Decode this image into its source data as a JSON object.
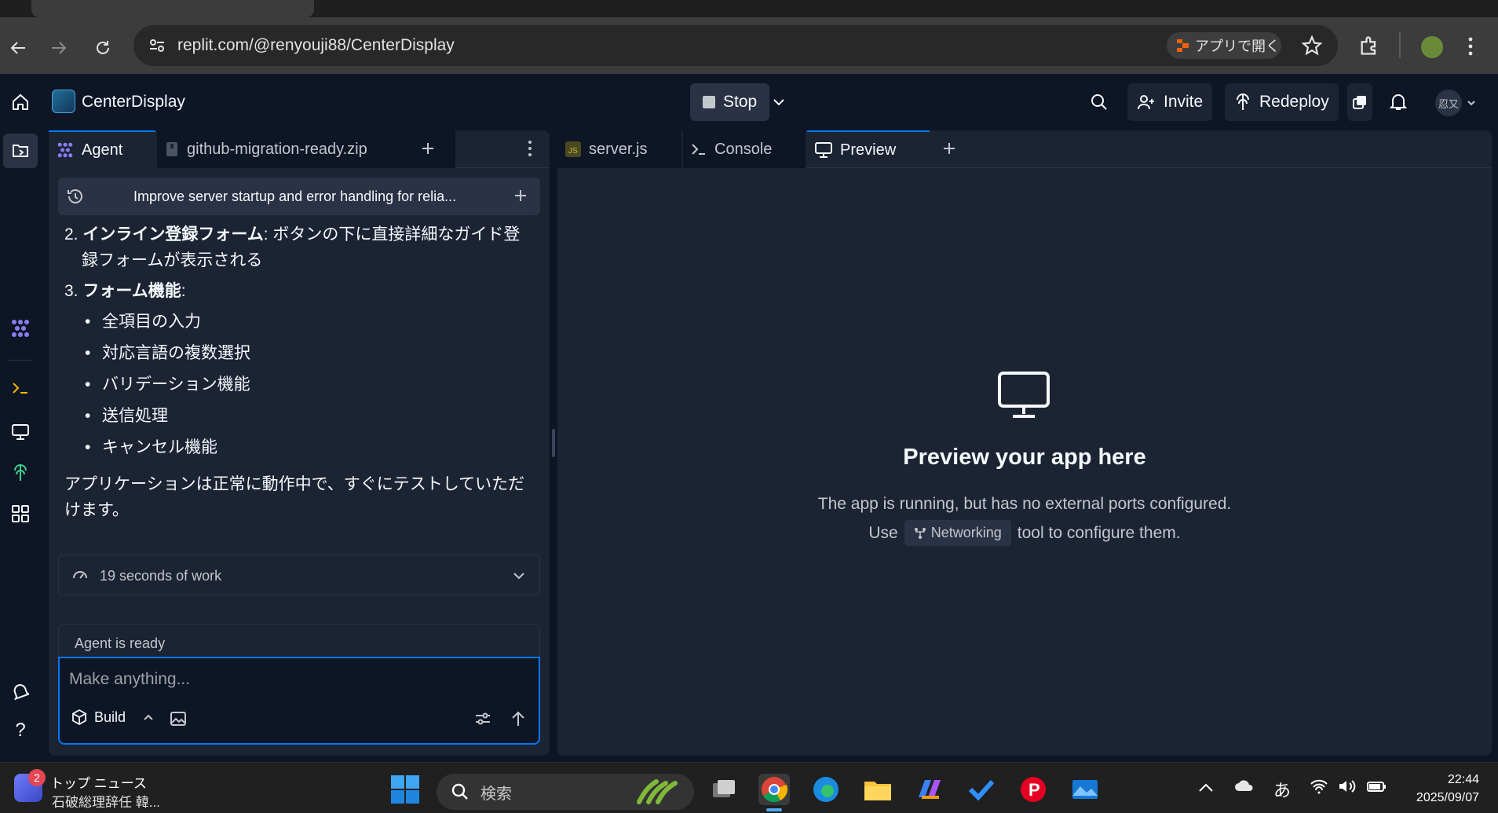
{
  "browser": {
    "url": "replit.com/@renyouji88/CenterDisplay",
    "open_in_app": "アプリで開く"
  },
  "header": {
    "project_name": "CenterDisplay",
    "stop_label": "Stop",
    "invite_label": "Invite",
    "redeploy_label": "Redeploy",
    "avatar_text": "忍又"
  },
  "left_tabs": [
    {
      "label": "Agent",
      "icon": "agent-icon"
    },
    {
      "label": "github-migration-ready.zip",
      "icon": "zip-file-icon"
    }
  ],
  "right_tabs": [
    {
      "label": "server.js",
      "icon": "js-file-icon"
    },
    {
      "label": "Console",
      "icon": "console-icon"
    },
    {
      "label": "Preview",
      "icon": "monitor-icon"
    }
  ],
  "chat": {
    "title": "Improve server startup and error handling for relia...",
    "item2_bold": "インライン登録フォーム",
    "item2_text": ": ボタンの下に直接詳細なガイド登録フォームが表示される",
    "item3_bold": "フォーム機能",
    "item3_text": ":",
    "bullets": [
      "全項目の入力",
      "対応言語の複数選択",
      "バリデーション機能",
      "送信処理",
      "キャンセル機能"
    ],
    "closing": "アプリケーションは正常に動作中で、すぐにテストしていただけます。",
    "work_label": "19 seconds of work",
    "status": "Agent is ready",
    "input_placeholder": "Make anything...",
    "build_label": "Build"
  },
  "preview": {
    "title": "Preview your app here",
    "desc": "The app is running, but has no external ports configured.",
    "use": "Use",
    "networking": "Networking",
    "tool_text": "tool to configure them."
  },
  "taskbar": {
    "news_badge": "2",
    "news_title": "トップ ニュース",
    "news_sub": "石破総理辞任 韓...",
    "search_label": "検索",
    "ime": "あ",
    "time": "22:44",
    "date": "2025/09/07"
  },
  "colors": {
    "bg": "#0e1525",
    "panel": "#1c2333",
    "accent": "#0079f2",
    "agent_purple": "#8b7cf6"
  }
}
